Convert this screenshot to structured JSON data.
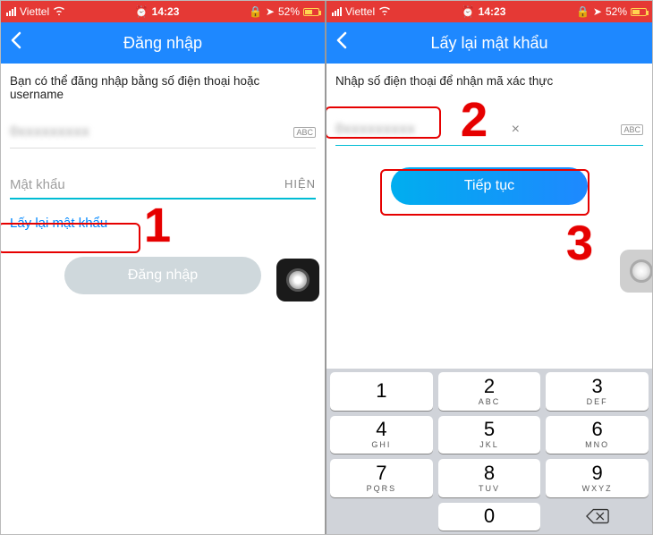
{
  "status": {
    "carrier": "Viettel",
    "time": "14:23",
    "battery": "52%",
    "nav_icon": "➤"
  },
  "left": {
    "title": "Đăng nhập",
    "hint": "Bạn có thể đăng nhập bằng số điện thoại hoặc username",
    "phone_masked": "0xxxxxxxxx",
    "abc": "ABC",
    "password_placeholder": "Mật khẩu",
    "show_label": "HIỆN",
    "forgot_label": "Lấy lại mật khẩu",
    "login_label": "Đăng nhập"
  },
  "right": {
    "title": "Lấy lại mật khẩu",
    "hint": "Nhập số điện thoại để nhận mã xác thực",
    "phone_masked": "0xxxxxxxxx",
    "abc": "ABC",
    "continue_label": "Tiếp tục"
  },
  "annotations": {
    "n1": "1",
    "n2": "2",
    "n3": "3"
  },
  "keypad": {
    "keys": [
      {
        "d": "1",
        "l": ""
      },
      {
        "d": "2",
        "l": "ABC"
      },
      {
        "d": "3",
        "l": "DEF"
      },
      {
        "d": "4",
        "l": "GHI"
      },
      {
        "d": "5",
        "l": "JKL"
      },
      {
        "d": "6",
        "l": "MNO"
      },
      {
        "d": "7",
        "l": "PQRS"
      },
      {
        "d": "8",
        "l": "TUV"
      },
      {
        "d": "9",
        "l": "WXYZ"
      }
    ],
    "zero": {
      "d": "0",
      "l": ""
    }
  }
}
